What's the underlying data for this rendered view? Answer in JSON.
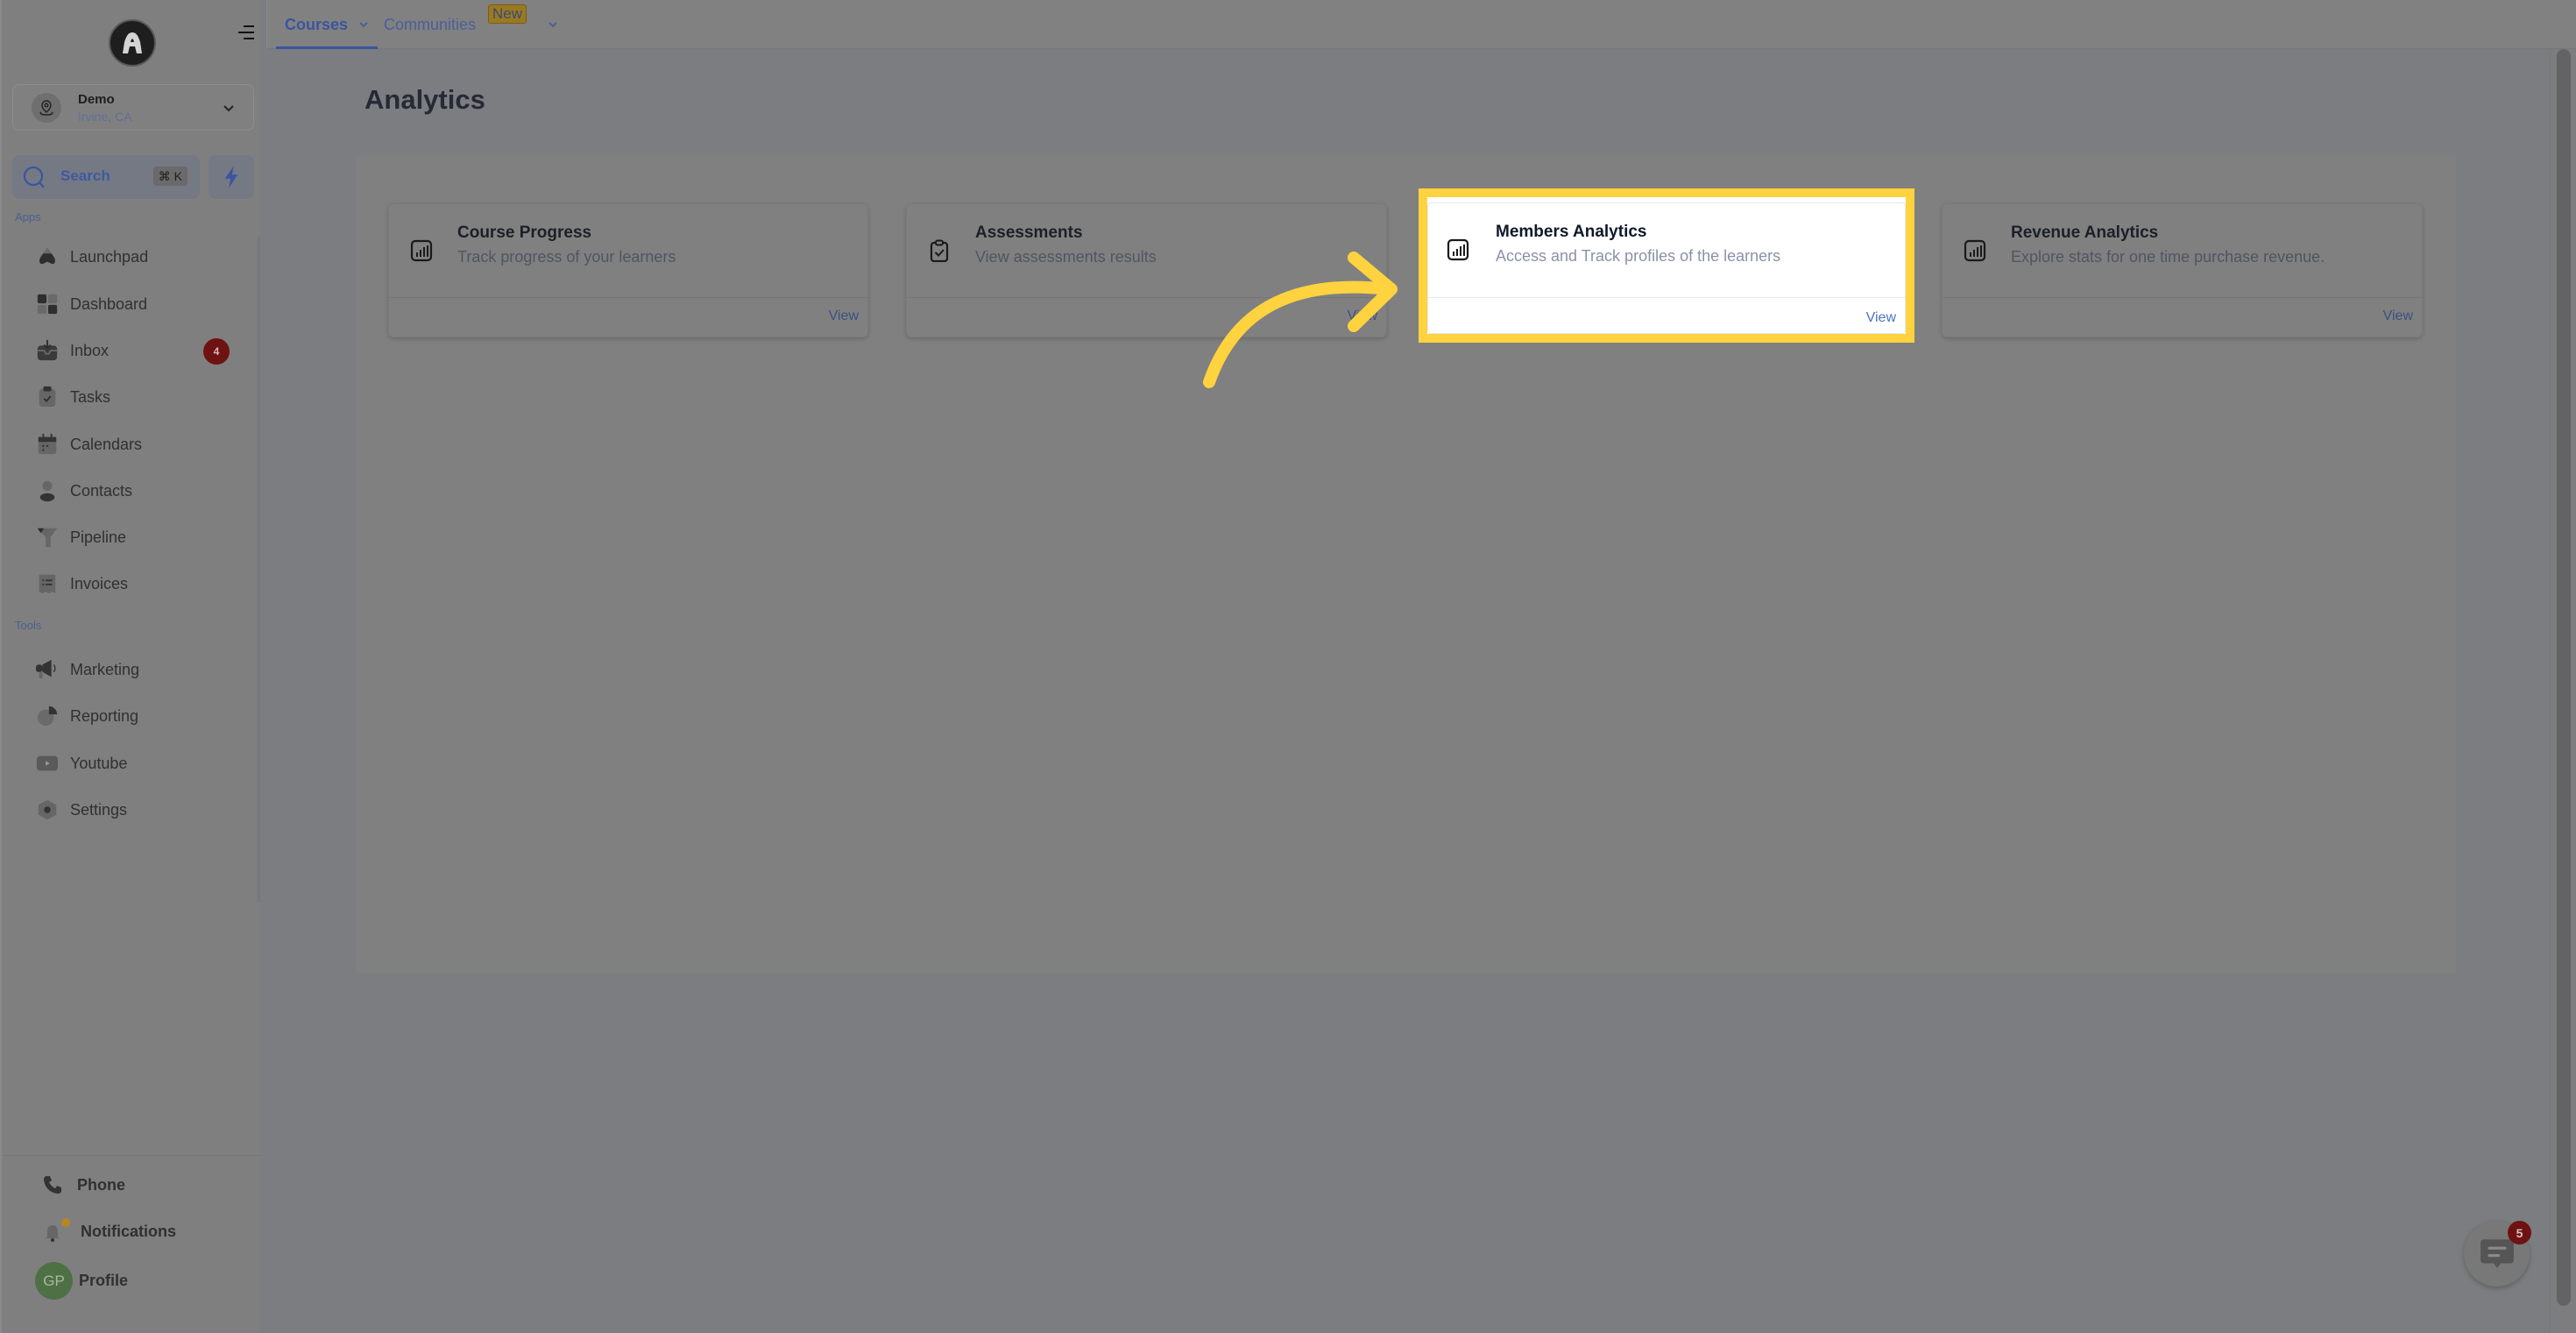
{
  "sidebar": {
    "logo_letter": "A",
    "location": {
      "name": "Demo",
      "subtitle": "Irvine, CA"
    },
    "search": {
      "label": "Search",
      "shortcut": "⌘ K"
    },
    "apps_label": "Apps",
    "apps": [
      {
        "label": "Launchpad",
        "icon": "launchpad-icon"
      },
      {
        "label": "Dashboard",
        "icon": "dashboard-icon"
      },
      {
        "label": "Inbox",
        "icon": "inbox-icon",
        "badge": "4"
      },
      {
        "label": "Tasks",
        "icon": "tasks-icon"
      },
      {
        "label": "Calendars",
        "icon": "calendar-icon"
      },
      {
        "label": "Contacts",
        "icon": "contacts-icon"
      },
      {
        "label": "Pipeline",
        "icon": "pipeline-icon"
      },
      {
        "label": "Invoices",
        "icon": "invoices-icon"
      }
    ],
    "tools_label": "Tools",
    "tools": [
      {
        "label": "Marketing",
        "icon": "megaphone-icon"
      },
      {
        "label": "Reporting",
        "icon": "pie-chart-icon"
      },
      {
        "label": "Youtube",
        "icon": "youtube-icon"
      },
      {
        "label": "Settings",
        "icon": "settings-icon"
      }
    ],
    "bottom": {
      "phone": "Phone",
      "notifications": "Notifications",
      "profile": "Profile",
      "avatar_initials": "GP"
    }
  },
  "topbar": {
    "tabs": [
      {
        "label": "Courses",
        "active": true
      },
      {
        "label": "Communities",
        "badge": "New"
      }
    ]
  },
  "main": {
    "title": "Analytics",
    "cards": [
      {
        "title": "Course Progress",
        "description": "Track progress of your learners",
        "action": "View",
        "icon": "bar-chart-icon"
      },
      {
        "title": "Assessments",
        "description": "View assessments results",
        "action": "View",
        "icon": "clipboard-check-icon"
      },
      {
        "title": "Members Analytics",
        "description": "Access and Track profiles of the learners",
        "action": "View",
        "icon": "bar-chart-icon",
        "highlighted": true
      },
      {
        "title": "Revenue Analytics",
        "description": "Explore stats for one time purchase revenue.",
        "action": "View",
        "icon": "bar-chart-icon"
      }
    ]
  },
  "chat_widget": {
    "badge": "5"
  },
  "colors": {
    "accent": "#3a55a0",
    "highlight": "#ffd23f",
    "badge": "#6e1212",
    "overlay": "#7f7f7f"
  }
}
